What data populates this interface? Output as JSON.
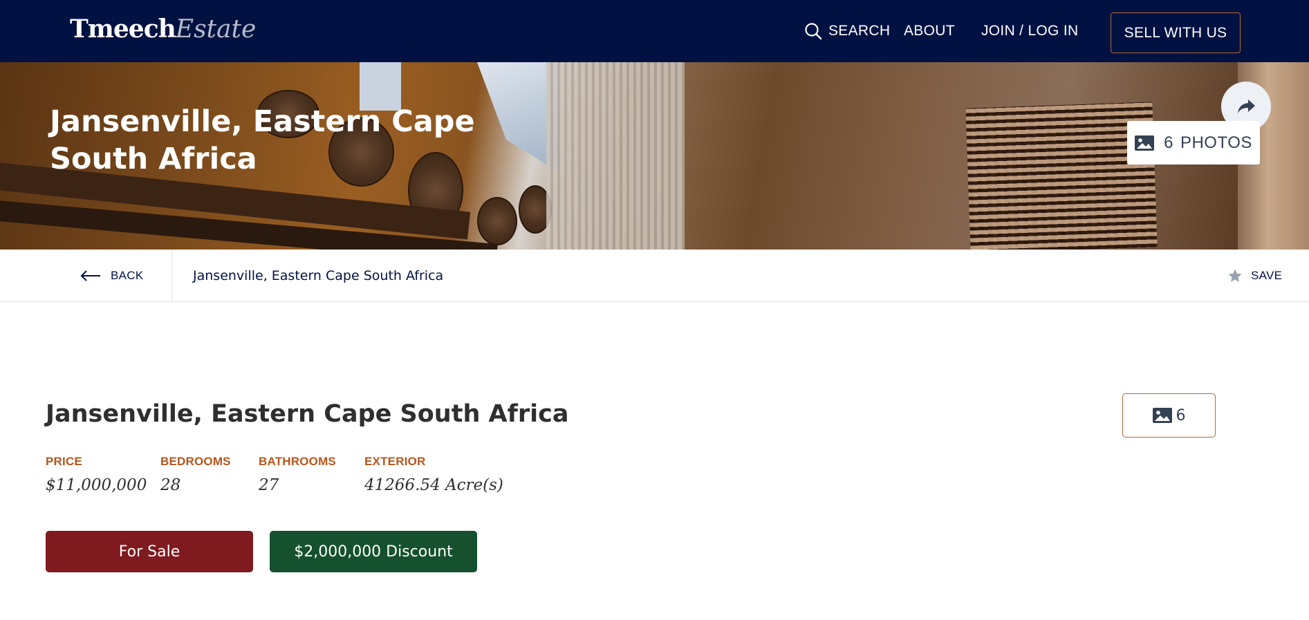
{
  "header": {
    "logo": {
      "bold": "Tmeech",
      "italic": "Estate"
    },
    "nav": {
      "search": "SEARCH",
      "about": "ABOUT",
      "join": "JOIN / LOG IN",
      "sell": "SELL WITH US"
    }
  },
  "hero": {
    "title": "Jansenville, Eastern Cape South Africa",
    "share_icon": "share-arrow-icon",
    "photos_count": "6",
    "photos_label": "PHOTOS",
    "photo_icon": "image-icon"
  },
  "subbar": {
    "back_label": "BACK",
    "title": "Jansenville, Eastern Cape South Africa",
    "save_label": "SAVE",
    "back_icon": "arrow-left-icon",
    "save_icon": "star-icon"
  },
  "listing": {
    "title": "Jansenville, Eastern Cape South Africa",
    "photo_count": "6",
    "stats": {
      "price": {
        "label": "PRICE",
        "value": "$11,000,000"
      },
      "bedrooms": {
        "label": "BEDROOMS",
        "value": "28"
      },
      "bathrooms": {
        "label": "BATHROOMS",
        "value": "27"
      },
      "exterior": {
        "label": "EXTERIOR",
        "value": "41266.54 Acre(s)"
      }
    },
    "status": "For Sale",
    "discount": "$2,000,000 Discount"
  },
  "colors": {
    "navy": "#011242",
    "accent": "#b06a2f",
    "label_orange": "#b5561a",
    "sale_red": "#7f1a1e",
    "discount_green": "#15512e"
  }
}
